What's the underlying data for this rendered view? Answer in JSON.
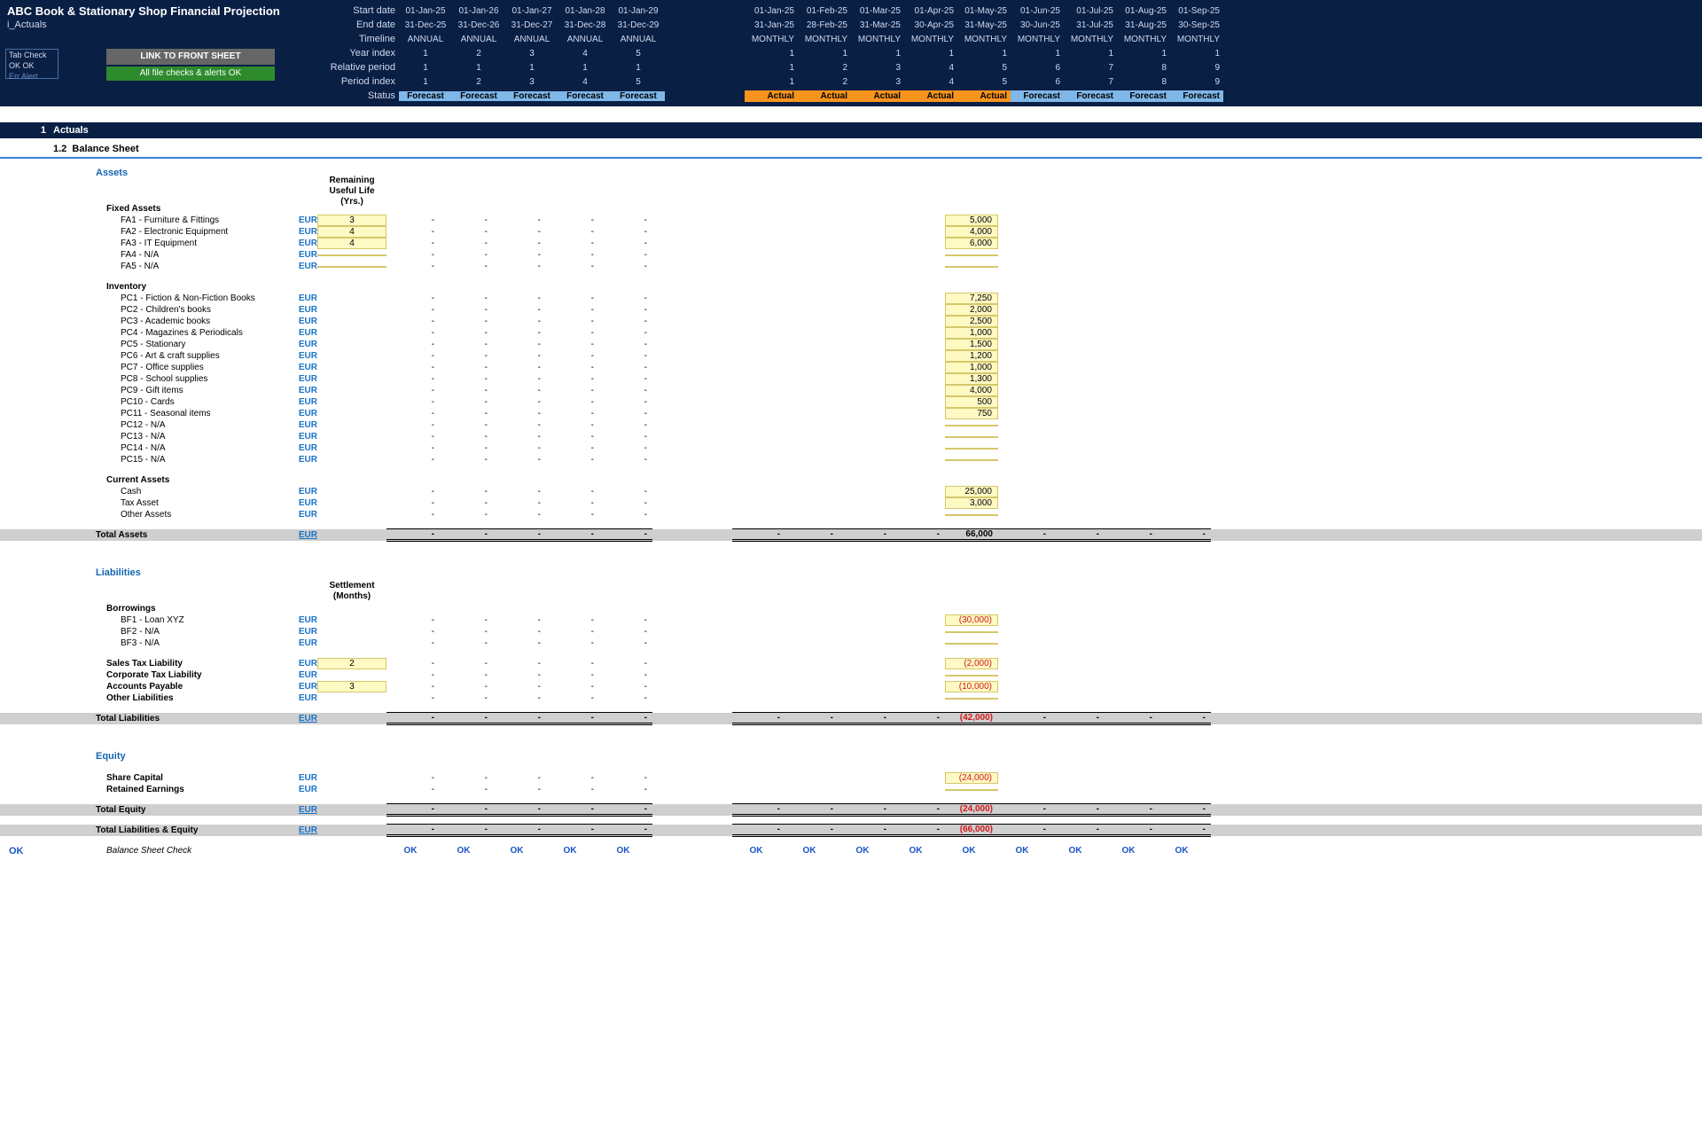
{
  "header": {
    "title": "ABC Book & Stationary Shop Financial Projection",
    "subtitle": "i_Actuals",
    "link_front": "LINK TO FRONT SHEET",
    "alerts_ok": "All file checks & alerts OK",
    "tab_check": "Tab Check",
    "ok_ok": "OK   OK",
    "err_alert": "Err   Alert",
    "labels": [
      "Start date",
      "End date",
      "Timeline",
      "Year index",
      "Relative period",
      "Period index",
      "Status"
    ],
    "annual": {
      "start": [
        "01-Jan-25",
        "01-Jan-26",
        "01-Jan-27",
        "01-Jan-28",
        "01-Jan-29"
      ],
      "end": [
        "31-Dec-25",
        "31-Dec-26",
        "31-Dec-27",
        "31-Dec-28",
        "31-Dec-29"
      ],
      "timeline": [
        "ANNUAL",
        "ANNUAL",
        "ANNUAL",
        "ANNUAL",
        "ANNUAL"
      ],
      "yidx": [
        "1",
        "2",
        "3",
        "4",
        "5"
      ],
      "rel": [
        "1",
        "1",
        "1",
        "1",
        "1"
      ],
      "pidx": [
        "1",
        "2",
        "3",
        "4",
        "5"
      ],
      "status": [
        "Forecast",
        "Forecast",
        "Forecast",
        "Forecast",
        "Forecast"
      ]
    },
    "monthly": {
      "start": [
        "01-Jan-25",
        "01-Feb-25",
        "01-Mar-25",
        "01-Apr-25",
        "01-May-25",
        "01-Jun-25",
        "01-Jul-25",
        "01-Aug-25",
        "01-Sep-25"
      ],
      "end": [
        "31-Jan-25",
        "28-Feb-25",
        "31-Mar-25",
        "30-Apr-25",
        "31-May-25",
        "30-Jun-25",
        "31-Jul-25",
        "31-Aug-25",
        "30-Sep-25"
      ],
      "timeline": [
        "MONTHLY",
        "MONTHLY",
        "MONTHLY",
        "MONTHLY",
        "MONTHLY",
        "MONTHLY",
        "MONTHLY",
        "MONTHLY",
        "MONTHLY"
      ],
      "yidx": [
        "1",
        "1",
        "1",
        "1",
        "1",
        "1",
        "1",
        "1",
        "1"
      ],
      "rel": [
        "1",
        "2",
        "3",
        "4",
        "5",
        "6",
        "7",
        "8",
        "9"
      ],
      "pidx": [
        "1",
        "2",
        "3",
        "4",
        "5",
        "6",
        "7",
        "8",
        "9"
      ],
      "status": [
        "Actual",
        "Actual",
        "Actual",
        "Actual",
        "Actual",
        "Forecast",
        "Forecast",
        "Forecast",
        "Forecast"
      ]
    }
  },
  "section_num": "1",
  "section_title": "Actuals",
  "sub_num": "1.2",
  "sub_title": "Balance Sheet",
  "assets_title": "Assets",
  "rul_head": "Remaining Useful Life (Yrs.)",
  "settle_head": "Settlement (Months)",
  "fixed_assets": "Fixed Assets",
  "fa": [
    {
      "name": "FA1 - Furniture & Fittings",
      "rul": "3",
      "val": "5,000"
    },
    {
      "name": "FA2 - Electronic Equipment",
      "rul": "4",
      "val": "4,000"
    },
    {
      "name": "FA3 - IT Equipment",
      "rul": "4",
      "val": "6,000"
    },
    {
      "name": "FA4 - N/A",
      "rul": "",
      "val": ""
    },
    {
      "name": "FA5 - N/A",
      "rul": "",
      "val": ""
    }
  ],
  "inventory": "Inventory",
  "inv": [
    {
      "name": "PC1 - Fiction & Non-Fiction Books",
      "val": "7,250"
    },
    {
      "name": "PC2 - Children's books",
      "val": "2,000"
    },
    {
      "name": "PC3 - Academic books",
      "val": "2,500"
    },
    {
      "name": "PC4 - Magazines & Periodicals",
      "val": "1,000"
    },
    {
      "name": "PC5 - Stationary",
      "val": "1,500"
    },
    {
      "name": "PC6 - Art & craft supplies",
      "val": "1,200"
    },
    {
      "name": "PC7 - Office supplies",
      "val": "1,000"
    },
    {
      "name": "PC8 - School supplies",
      "val": "1,300"
    },
    {
      "name": "PC9 - Gift items",
      "val": "4,000"
    },
    {
      "name": "PC10 - Cards",
      "val": "500"
    },
    {
      "name": "PC11 - Seasonal items",
      "val": "750"
    },
    {
      "name": "PC12 - N/A",
      "val": ""
    },
    {
      "name": "PC13 - N/A",
      "val": ""
    },
    {
      "name": "PC14 - N/A",
      "val": ""
    },
    {
      "name": "PC15 - N/A",
      "val": ""
    }
  ],
  "current_assets": "Current Assets",
  "ca": [
    {
      "name": "Cash",
      "val": "25,000"
    },
    {
      "name": "Tax Asset",
      "val": "3,000"
    },
    {
      "name": "Other Assets",
      "val": ""
    }
  ],
  "total_assets": "Total Assets",
  "total_assets_val": "66,000",
  "liab_title": "Liabilities",
  "borrowings": "Borrowings",
  "bf": [
    {
      "name": "BF1 - Loan XYZ",
      "val": "(30,000)",
      "neg": true
    },
    {
      "name": "BF2 - N/A",
      "val": ""
    },
    {
      "name": "BF3 - N/A",
      "val": ""
    }
  ],
  "other_liab": [
    {
      "name": "Sales Tax Liability",
      "set": "2",
      "val": "(2,000)",
      "neg": true
    },
    {
      "name": "Corporate Tax Liability",
      "set": "",
      "val": ""
    },
    {
      "name": "Accounts Payable",
      "set": "3",
      "val": "(10,000)",
      "neg": true
    },
    {
      "name": "Other Liabilities",
      "set": "",
      "val": ""
    }
  ],
  "total_liab": "Total Liabilities",
  "total_liab_val": "(42,000)",
  "equity_title": "Equity",
  "eq": [
    {
      "name": "Share Capital",
      "val": "(24,000)",
      "neg": true
    },
    {
      "name": "Retained Earnings",
      "val": ""
    }
  ],
  "total_eq": "Total Equity",
  "total_eq_val": "(24,000)",
  "total_le": "Total Liabilities & Equity",
  "total_le_val": "(66,000)",
  "bs_check": "Balance Sheet Check",
  "ok": "OK",
  "cur": "EUR",
  "dash": "-"
}
